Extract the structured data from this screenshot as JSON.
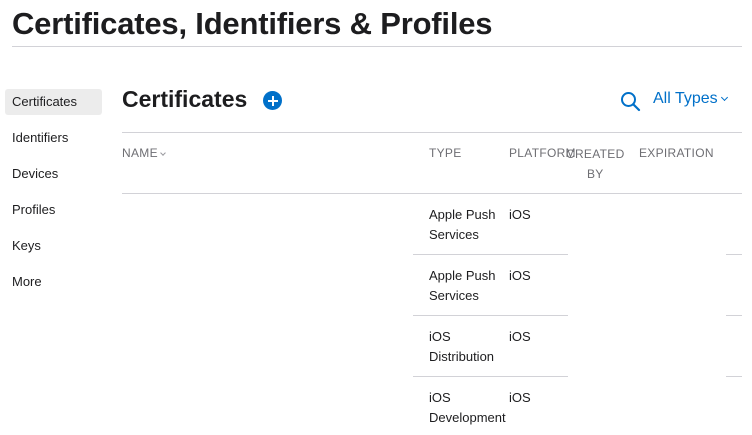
{
  "page": {
    "title": "Certificates, Identifiers & Profiles"
  },
  "sidebar": {
    "items": [
      {
        "label": "Certificates",
        "active": true
      },
      {
        "label": "Identifiers"
      },
      {
        "label": "Devices"
      },
      {
        "label": "Profiles"
      },
      {
        "label": "Keys"
      },
      {
        "label": "More"
      }
    ]
  },
  "section": {
    "title": "Certificates",
    "filter_label": "All Types",
    "icons": {
      "add": "plus-circle-icon",
      "search": "search-icon",
      "filter": "chevron-down-icon"
    }
  },
  "table": {
    "columns": {
      "name": "NAME",
      "type": "TYPE",
      "platform": "PLATFORM",
      "created_by_line1": "CREATED",
      "created_by_line2": "BY",
      "expiration": "EXPIRATION"
    },
    "rows": [
      {
        "type_line1": "Apple Push",
        "type_line2": "Services",
        "platform": "iOS"
      },
      {
        "type_line1": "Apple Push",
        "type_line2": "Services",
        "platform": "iOS"
      },
      {
        "type_line1": "iOS",
        "type_line2": "Distribution",
        "platform": "iOS"
      },
      {
        "type_line1": "iOS",
        "type_line2": "Development",
        "platform": "iOS"
      }
    ]
  },
  "colors": {
    "accent": "#0070c9",
    "text": "#1d1d1f",
    "muted": "#6e6e73",
    "divider": "#d2d2d7",
    "active_bg": "#ececec"
  }
}
